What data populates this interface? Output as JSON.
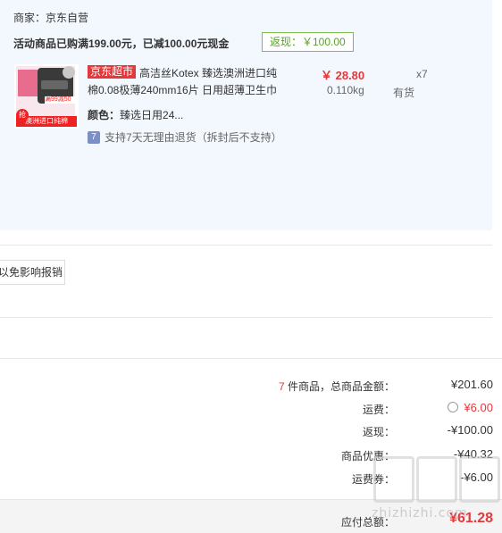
{
  "order": {
    "merchant": "商家：京东自营",
    "promo": "活动商品已购满199.00元，已减100.00元现金",
    "rebate_badge": "返现：￥100.00"
  },
  "item": {
    "store_tag": "京东超市",
    "title": "高洁丝Kotex 臻选澳洲进口纯棉0.08极薄240mm16片 日用超薄卫生巾",
    "price": "￥ 28.80",
    "weight": "0.110kg",
    "quantity": "x7",
    "stock": "有货",
    "color_label": "颜色：",
    "color_value": "臻选日用24...",
    "return_icon_text": "7",
    "return_policy": "支持7天无理由退货（拆封后不支持）",
    "thumb_text": {
      "promo": "满99减50",
      "bottom": "澳洲进口纯棉",
      "qiang": "抢"
    }
  },
  "tip": {
    "text": "以免影响报销"
  },
  "summary": {
    "count": "7",
    "count_suffix": " 件商品，总商品金额：",
    "goods_total": "¥201.60",
    "shipping_label": "运费：",
    "shipping_value": "¥6.00",
    "rebate_label": "返现：",
    "rebate_value": "-¥100.00",
    "discount_label": "商品优惠：",
    "discount_value": "-¥40.32",
    "coupon_label": "运费券：",
    "coupon_value": "-¥6.00",
    "payable_label": "应付总额：",
    "payable_value": "¥61.28"
  },
  "watermark": {
    "url": "zhizhizhi.com"
  },
  "colors": {
    "accent_red": "#e4393c",
    "rebate_green": "#5aa02c",
    "panel_bg": "#f3f8fe"
  }
}
